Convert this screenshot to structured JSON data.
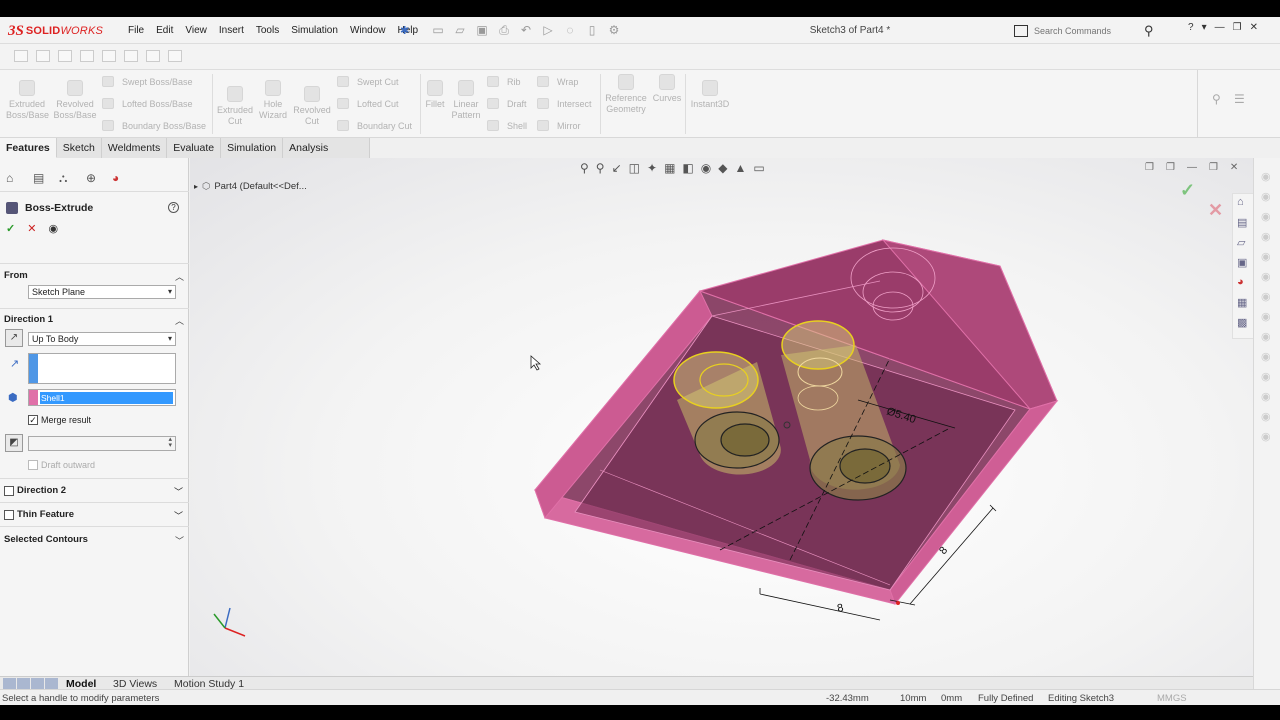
{
  "brand": {
    "ds": "3S",
    "name_bold": "SOLID",
    "name_italic": "WORKS"
  },
  "menu": [
    "File",
    "Edit",
    "View",
    "Insert",
    "Tools",
    "Simulation",
    "Window",
    "Help"
  ],
  "document_title": "Sketch3 of Part4 *",
  "search": {
    "placeholder": "Search Commands"
  },
  "help_label": "?",
  "ribbon": {
    "extruded_boss": "Extruded Boss/Base",
    "revolved_boss": "Revolved Boss/Base",
    "swept_boss": "Swept Boss/Base",
    "lofted_boss": "Lofted Boss/Base",
    "boundary_boss": "Boundary Boss/Base",
    "extruded_cut": "Extruded Cut",
    "hole_wizard": "Hole Wizard",
    "revolved_cut": "Revolved Cut",
    "swept_cut": "Swept Cut",
    "lofted_cut": "Lofted Cut",
    "boundary_cut": "Boundary Cut",
    "fillet": "Fillet",
    "linear_pattern": "Linear Pattern",
    "rib": "Rib",
    "draft": "Draft",
    "shell": "Shell",
    "wrap": "Wrap",
    "intersect": "Intersect",
    "mirror": "Mirror",
    "reference_geometry": "Reference Geometry",
    "curves": "Curves",
    "instant3d": "Instant3D"
  },
  "tabs": [
    "Features",
    "Sketch",
    "Weldments",
    "Evaluate",
    "Simulation",
    "Analysis Preparation"
  ],
  "property_manager": {
    "title": "Boss-Extrude",
    "from_label": "From",
    "from_value": "Sketch Plane",
    "direction1_label": "Direction 1",
    "direction1_value": "Up To Body",
    "body_value": "Shell1",
    "merge_result_label": "Merge result",
    "merge_result_checked": true,
    "draft_outward_label": "Draft outward",
    "direction2_label": "Direction 2",
    "thin_feature_label": "Thin Feature",
    "selected_contours_label": "Selected Contours"
  },
  "graphics": {
    "tree_label": "Part4  (Default<<Def...",
    "dim_diameter": "Ø5.40",
    "dim_width": "8",
    "dim_depth": "8"
  },
  "bottom_tabs": [
    "Model",
    "3D Views",
    "Motion Study 1"
  ],
  "status": {
    "message": "Select a handle to modify parameters",
    "x": "-32.43mm",
    "y": "10mm",
    "z": "0mm",
    "definition": "Fully Defined",
    "editing": "Editing Sketch3",
    "units": "MMGS"
  },
  "colors": {
    "accent_red": "#d22222",
    "part_pink": "#c0407a",
    "selection_blue": "#3399ff",
    "sketch_yellow": "#e8d020"
  }
}
